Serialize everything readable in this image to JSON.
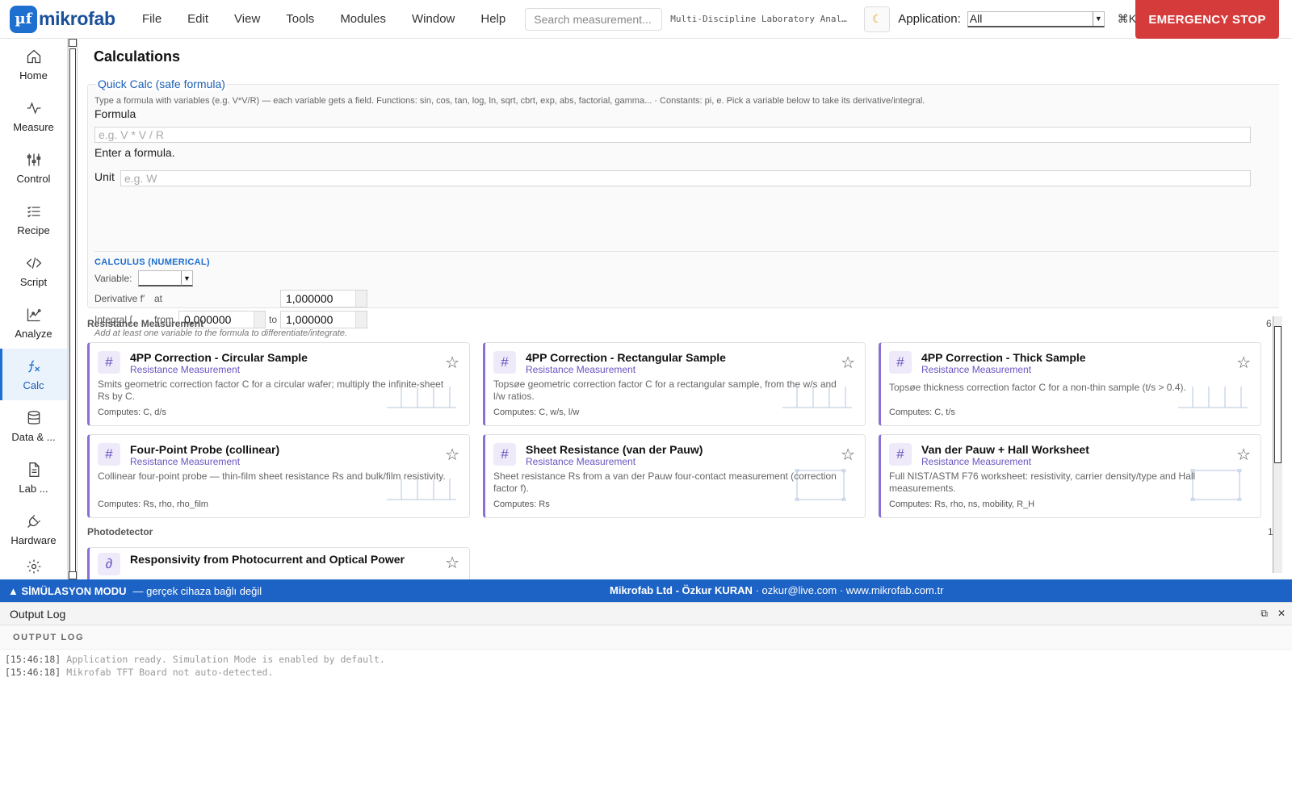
{
  "topbar": {
    "logo_mark": "µf",
    "logo_text": "mikrofab",
    "menu": [
      "File",
      "Edit",
      "View",
      "Tools",
      "Modules",
      "Window",
      "Help"
    ],
    "search_placeholder": "Search measurement...",
    "subtitle": "Multi-Discipline Laboratory Anal…",
    "theme_icon": "moon-icon",
    "application_label": "Application:",
    "application_value": "All",
    "shortcut": "⌘K",
    "emergency_stop": "EMERGENCY STOP"
  },
  "sidebar": {
    "items": [
      {
        "label": "Home",
        "icon": "home-icon"
      },
      {
        "label": "Measure",
        "icon": "wave-icon"
      },
      {
        "label": "Control",
        "icon": "sliders-icon"
      },
      {
        "label": "Recipe",
        "icon": "list-icon"
      },
      {
        "label": "Script",
        "icon": "code-icon"
      },
      {
        "label": "Analyze",
        "icon": "chart-icon"
      },
      {
        "label": "Calc",
        "icon": "function-icon",
        "active": true
      },
      {
        "label": "Data & ...",
        "icon": "database-icon"
      },
      {
        "label": "Lab ...",
        "icon": "document-icon"
      },
      {
        "label": "Hardware",
        "icon": "plug-icon"
      }
    ]
  },
  "main": {
    "title": "Calculations",
    "quick_calc": {
      "title": "Quick Calc (safe formula)",
      "help": "Type a formula with variables (e.g. V*V/R) — each variable gets a field. Functions: sin, cos, tan, log, ln, sqrt, cbrt, exp, abs, factorial, gamma... · Constants: pi, e. Pick a variable below to take its derivative/integral.",
      "formula_label": "Formula",
      "formula_placeholder": "e.g. V * V / R",
      "formula_status": "Enter a formula.",
      "unit_label": "Unit",
      "unit_placeholder": "e.g. W"
    },
    "calculus": {
      "heading": "CALCULUS (NUMERICAL)",
      "variable_label": "Variable:",
      "derivative_label": "Derivative f′",
      "at_label": "at",
      "at_value": "1,000000",
      "integral_label": "Integral ∫",
      "from_label": "from",
      "from_value": "0,000000",
      "to_label": "to",
      "to_value": "1,000000",
      "note": "Add at least one variable to the formula to differentiate/integrate."
    },
    "sections": [
      {
        "name": "Resistance Measurement",
        "count": "6",
        "cards": [
          {
            "title": "4PP Correction - Circular Sample",
            "category": "Resistance Measurement",
            "description": "Smits geometric correction factor C for a circular wafer; multiply the infinite-sheet Rs by C.",
            "computes": "Computes: C, d/s"
          },
          {
            "title": "4PP Correction - Rectangular Sample",
            "category": "Resistance Measurement",
            "description": "Topsøe geometric correction factor C for a rectangular sample, from the w/s and l/w ratios.",
            "computes": "Computes: C, w/s, l/w"
          },
          {
            "title": "4PP Correction - Thick Sample",
            "category": "Resistance Measurement",
            "description": "Topsøe thickness correction factor C for a non-thin sample (t/s > 0.4).",
            "computes": "Computes: C, t/s"
          },
          {
            "title": "Four-Point Probe (collinear)",
            "category": "Resistance Measurement",
            "description": "Collinear four-point probe — thin-film sheet resistance Rs and bulk/film resistivity.",
            "computes": "Computes: Rs, rho, rho_film"
          },
          {
            "title": "Sheet Resistance (van der Pauw)",
            "category": "Resistance Measurement",
            "description": "Sheet resistance Rs from a van der Pauw four-contact measurement (correction factor f).",
            "computes": "Computes: Rs"
          },
          {
            "title": "Van der Pauw + Hall Worksheet",
            "category": "Resistance Measurement",
            "description": "Full NIST/ASTM F76 worksheet: resistivity, carrier density/type and Hall measurements.",
            "computes": "Computes: Rs, rho, ns, mobility, R_H"
          }
        ]
      },
      {
        "name": "Photodetector",
        "count": "1",
        "cards": [
          {
            "title": "Responsivity from Photocurrent and Optical Power",
            "category": "",
            "description": "",
            "computes": ""
          }
        ]
      }
    ]
  },
  "statusbar": {
    "mode": "▲ SİMÜLASYON MODU",
    "mode_note": "— gerçek cihaza bağlı değil",
    "company": "Mikrofab Ltd - Özkur KURAN",
    "email": "ozkur@live.com",
    "website": "www.mikrofab.com.tr"
  },
  "log": {
    "title": "Output Log",
    "subtitle": "OUTPUT LOG",
    "lines": [
      {
        "time": "[15:46:18]",
        "text": "Application ready. Simulation Mode is enabled by default."
      },
      {
        "time": "[15:46:18]",
        "text": "Mikrofab TFT Board not auto-detected."
      }
    ]
  }
}
